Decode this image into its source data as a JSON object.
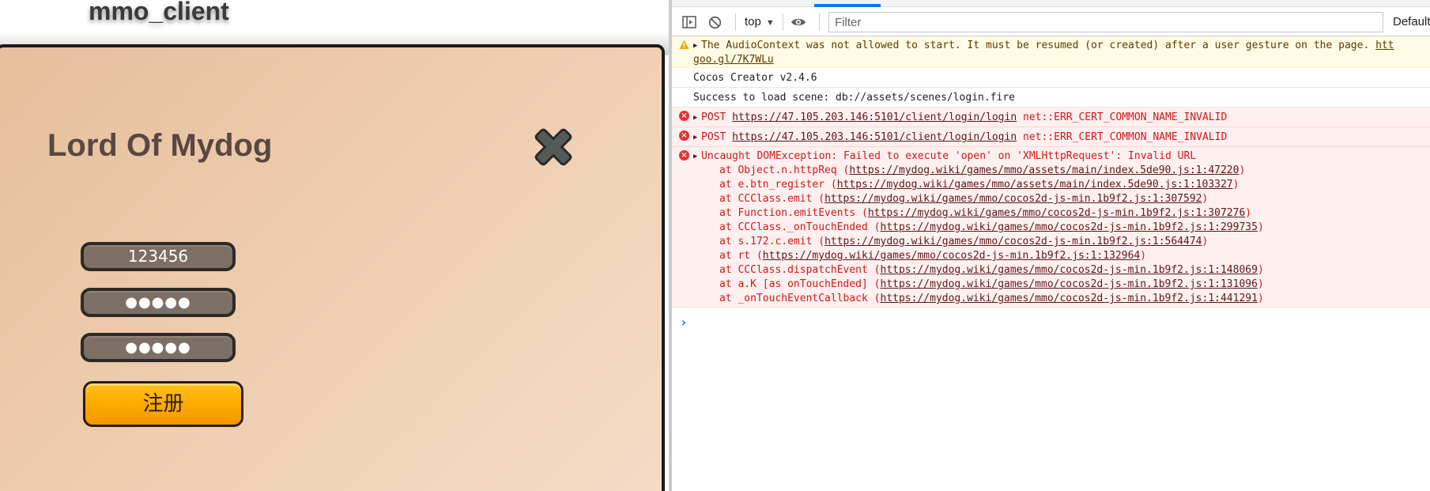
{
  "page": {
    "heading": "mmo_client"
  },
  "game": {
    "title": "Lord Of Mydog",
    "account_value": "123456",
    "password_value": "●●●●●",
    "confirm_value": "●●●●●",
    "register_label": "注册",
    "colors": {
      "panel": "#e9c4a3",
      "button": "#ffaa00",
      "field": "#7d6f65"
    }
  },
  "toolbar": {
    "context": "top",
    "filter_placeholder": "Filter",
    "levels": "Default"
  },
  "console": {
    "warning": {
      "text": "The AudioContext was not allowed to start. It must be resumed (or created) after a user gesture on the page. ",
      "link_1": "htt",
      "link_2": "goo.gl/7K7WLu"
    },
    "info_1": "Cocos Creator v2.4.6",
    "info_2": "Success to load scene: db://assets/scenes/login.fire",
    "error_1": {
      "method": "POST",
      "url": "https://47.105.203.146:5101/client/login/login",
      "detail": "net::ERR_CERT_COMMON_NAME_INVALID"
    },
    "error_2": {
      "method": "POST",
      "url": "https://47.105.203.146:5101/client/login/login",
      "detail": "net::ERR_CERT_COMMON_NAME_INVALID"
    },
    "error_3": {
      "text": "Uncaught DOMException: Failed to execute 'open' on 'XMLHttpRequest': Invalid URL",
      "stack": [
        {
          "prefix": "at Object.n.httpReq (",
          "url": "https://mydog.wiki/games/mmo/assets/main/index.5de90.js:1:47220",
          "suffix": ")"
        },
        {
          "prefix": "at e.btn_register (",
          "url": "https://mydog.wiki/games/mmo/assets/main/index.5de90.js:1:103327",
          "suffix": ")"
        },
        {
          "prefix": "at CCClass.emit (",
          "url": "https://mydog.wiki/games/mmo/cocos2d-js-min.1b9f2.js:1:307592",
          "suffix": ")"
        },
        {
          "prefix": "at Function.emitEvents (",
          "url": "https://mydog.wiki/games/mmo/cocos2d-js-min.1b9f2.js:1:307276",
          "suffix": ")"
        },
        {
          "prefix": "at CCClass._onTouchEnded (",
          "url": "https://mydog.wiki/games/mmo/cocos2d-js-min.1b9f2.js:1:299735",
          "suffix": ")"
        },
        {
          "prefix": "at s.172.c.emit (",
          "url": "https://mydog.wiki/games/mmo/cocos2d-js-min.1b9f2.js:1:564474",
          "suffix": ")"
        },
        {
          "prefix": "at rt (",
          "url": "https://mydog.wiki/games/mmo/cocos2d-js-min.1b9f2.js:1:132964",
          "suffix": ")"
        },
        {
          "prefix": "at CCClass.dispatchEvent (",
          "url": "https://mydog.wiki/games/mmo/cocos2d-js-min.1b9f2.js:1:148069",
          "suffix": ")"
        },
        {
          "prefix": "at a.K [as onTouchEnded] (",
          "url": "https://mydog.wiki/games/mmo/cocos2d-js-min.1b9f2.js:1:131096",
          "suffix": ")"
        },
        {
          "prefix": "at _onTouchEventCallback (",
          "url": "https://mydog.wiki/games/mmo/cocos2d-js-min.1b9f2.js:1:441291",
          "suffix": ")"
        }
      ]
    },
    "prompt": "›"
  }
}
